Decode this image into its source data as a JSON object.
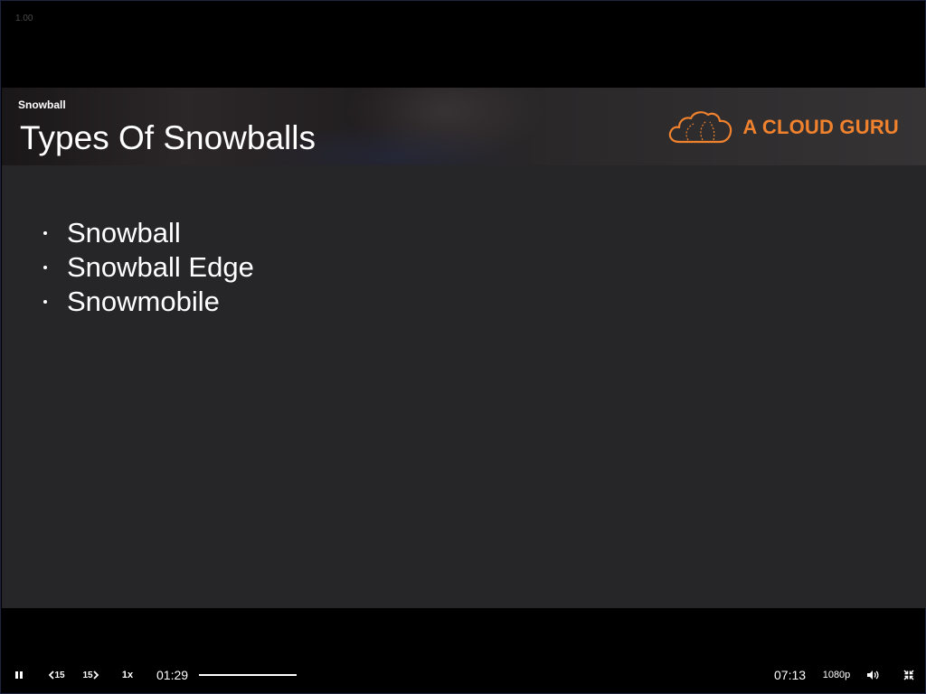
{
  "player": {
    "speed_overlay": "1.00"
  },
  "slide": {
    "section": "Snowball",
    "title": "Types Of Snowballs",
    "bullets": [
      "Snowball",
      "Snowball Edge",
      "Snowmobile"
    ],
    "logo_text": "A CLOUD GURU",
    "accent_color": "#f0822e",
    "background_color": "#262528"
  },
  "controls": {
    "play_pause_icon": "pause-icon",
    "skip_back_label": "15",
    "skip_forward_label": "15",
    "playback_rate": "1x",
    "current_time": "01:29",
    "duration": "07:13",
    "progress_fraction": 0.205,
    "quality": "1080p",
    "volume_icon": "volume-icon",
    "fullscreen_icon": "exit-fullscreen-icon"
  }
}
